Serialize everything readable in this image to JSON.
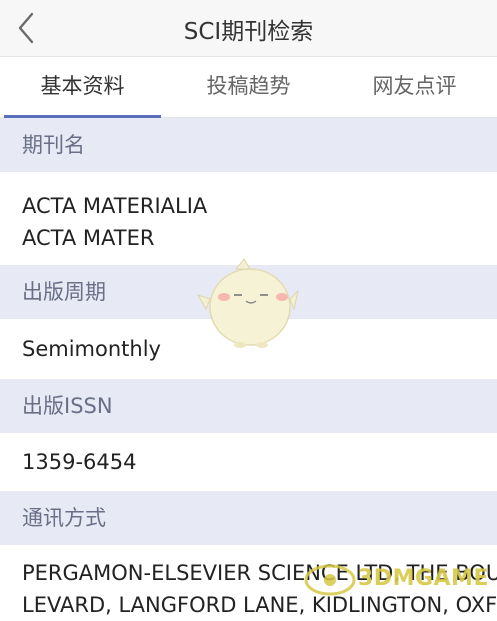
{
  "header": {
    "title": "SCI期刊检索"
  },
  "tabs": [
    {
      "label": "基本资料"
    },
    {
      "label": "投稿趋势"
    },
    {
      "label": "网友点评"
    }
  ],
  "sections": [
    {
      "label": "期刊名",
      "lines": [
        "ACTA MATERIALIA",
        "ACTA MATER"
      ]
    },
    {
      "label": "出版周期",
      "value": "Semimonthly"
    },
    {
      "label": "出版ISSN",
      "value": "1359-6454"
    },
    {
      "label": "通讯方式",
      "lines": [
        "PERGAMON-ELSEVIER SCIENCE LTD, THE BOU",
        "LEVARD, LANGFORD LANE, KIDLINGTON, OXF"
      ]
    }
  ],
  "watermark": {
    "text": "3DMGAME"
  },
  "colors": {
    "accent": "#5a6fb8",
    "section_bg": "#e7e9f5",
    "section_text": "#6a6f86"
  },
  "icons": {
    "back": "chevron-left-icon",
    "mascot": "mascot-icon"
  }
}
